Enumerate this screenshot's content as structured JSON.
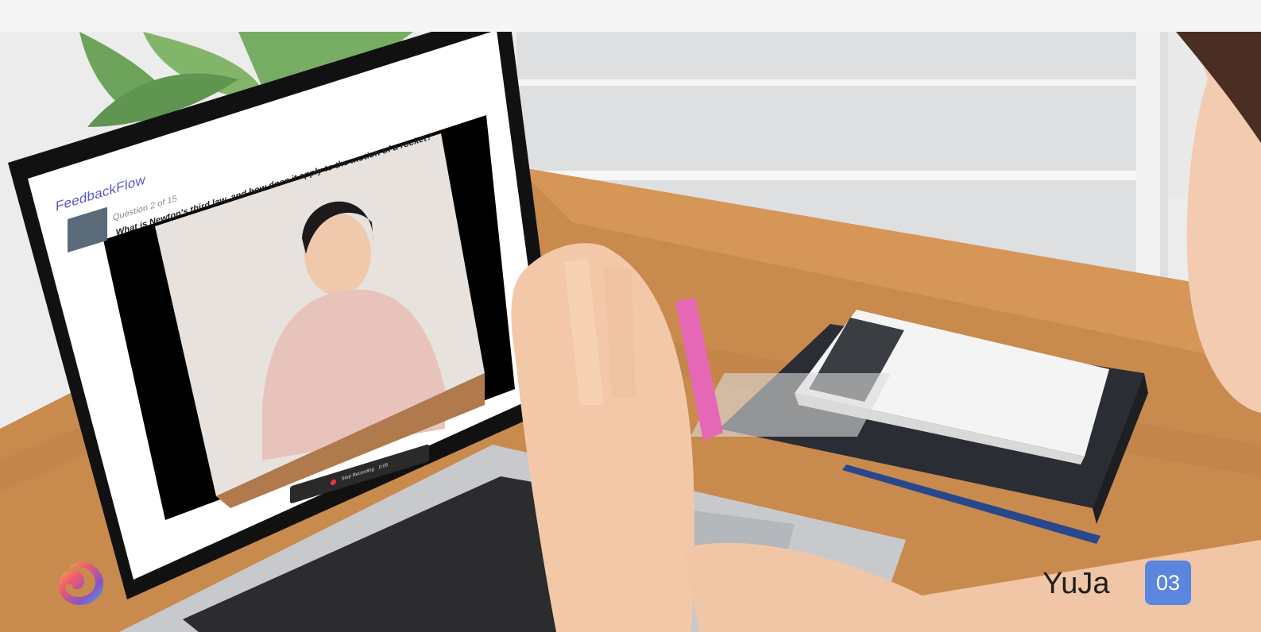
{
  "laptop_screen": {
    "app_title": "FeedbackFlow",
    "question_counter": "Question 2 of 15",
    "question_text": "What is Newton's third law, and how does it apply to the motion of a rocket?",
    "recording_label": "Stop Recording",
    "recording_time": "0:05"
  },
  "footer": {
    "brand_name": "YuJa",
    "page_number": "03"
  },
  "colors": {
    "accent_badge": "#5b86e0",
    "app_title": "#5a58c9",
    "record_dot": "#e03a3a"
  },
  "icons": {
    "logo": "swirl-logo-icon"
  }
}
